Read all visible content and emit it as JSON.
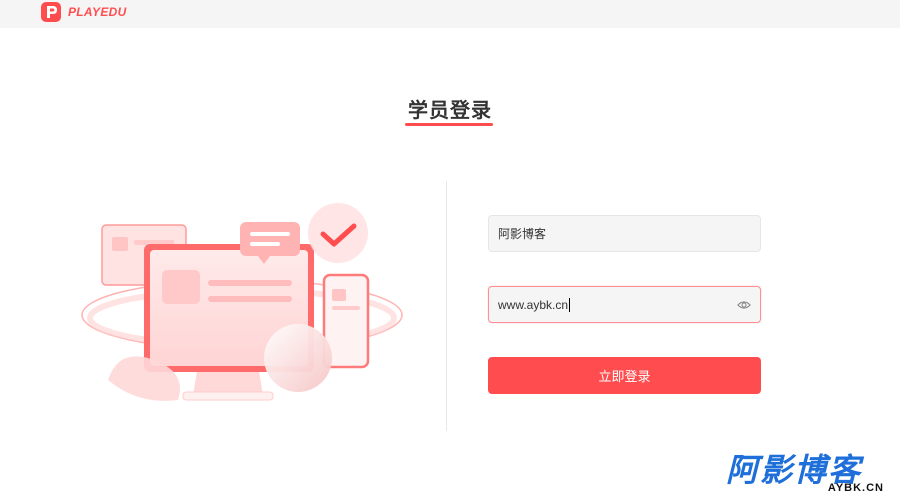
{
  "brand": {
    "name": "PLAYEDU",
    "icon": "playedu-logo-icon",
    "color": "#ff4d4f"
  },
  "login": {
    "title": "学员登录",
    "username": {
      "value": "阿影博客"
    },
    "password": {
      "value": "www.aybk.cn",
      "toggle_icon": "eye-icon"
    },
    "submit_label": "立即登录"
  },
  "illustration": {
    "icon": "computer-devices-illustration"
  },
  "watermark": {
    "main": "阿影博客",
    "sub": "AYBK.CN"
  },
  "colors": {
    "accent": "#ff4d4f",
    "header_bg": "#f5f5f5",
    "input_bg": "#f5f5f5",
    "watermark": "#1e6fd9"
  }
}
